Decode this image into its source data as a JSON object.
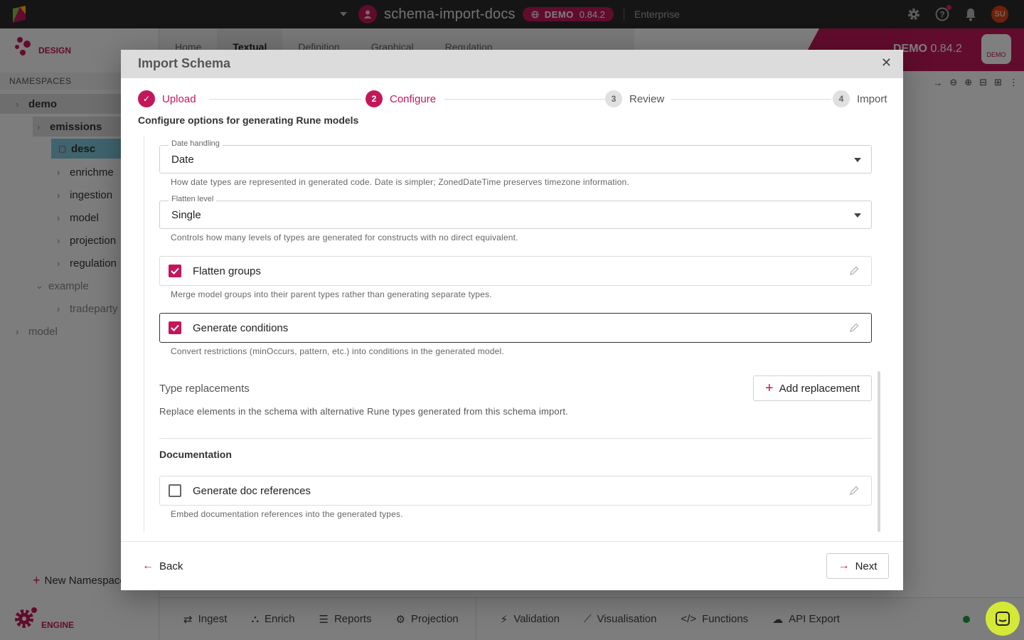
{
  "topbar": {
    "project_name": "schema-import-docs",
    "version_tag": "DEMO",
    "version": "0.84.2",
    "edition": "Enterprise",
    "user_initials": "SU",
    "icons": [
      "settings-icon",
      "help-icon",
      "bell-icon"
    ]
  },
  "sidebar": {
    "logo_label": "DESIGN",
    "namespaces_header": "NAMESPACES",
    "items": [
      {
        "label": "demo"
      },
      {
        "label": "emissions"
      },
      {
        "label": "desc"
      },
      {
        "label": "enrichme"
      },
      {
        "label": "ingestion"
      },
      {
        "label": "model"
      },
      {
        "label": "projection"
      },
      {
        "label": "regulation"
      },
      {
        "label": "example"
      },
      {
        "label": "tradeparty"
      },
      {
        "label": "model"
      }
    ],
    "new_namespace": "New Namespace",
    "engine_label": "ENGINE"
  },
  "tabs": [
    "Home",
    "Textual",
    "Definition",
    "Graphical",
    "Regulation"
  ],
  "demo_banner": {
    "tag": "DEMO",
    "version": "0.84.2",
    "box": "DEMO"
  },
  "bottom_bar": [
    "Ingest",
    "Enrich",
    "Reports",
    "Projection",
    "Validation",
    "Visualisation",
    "Functions",
    "API Export"
  ],
  "modal": {
    "title": "Import Schema",
    "steps": [
      {
        "number": "1",
        "label": "Upload",
        "state": "done"
      },
      {
        "number": "2",
        "label": "Configure",
        "state": "current"
      },
      {
        "number": "3",
        "label": "Review",
        "state": "pending"
      },
      {
        "number": "4",
        "label": "Import",
        "state": "pending"
      }
    ],
    "subtitle": "Configure options for generating Rune models",
    "date_handling": {
      "label": "Date handling",
      "value": "Date",
      "helper": "How date types are represented in generated code. Date is simpler; ZonedDateTime preserves timezone information."
    },
    "flatten_level": {
      "label": "Flatten level",
      "value": "Single",
      "helper": "Controls how many levels of types are generated for constructs with no direct equivalent."
    },
    "flatten_groups": {
      "label": "Flatten groups",
      "checked": true,
      "helper": "Merge model groups into their parent types rather than generating separate types."
    },
    "generate_conditions": {
      "label": "Generate conditions",
      "checked": true,
      "helper": "Convert restrictions (minOccurs, pattern, etc.) into conditions in the generated model."
    },
    "type_replacements": {
      "label": "Type replacements",
      "add_button": "Add replacement",
      "description": "Replace elements in the schema with alternative Rune types generated from this schema import."
    },
    "documentation": {
      "title": "Documentation",
      "generate_doc_refs": {
        "label": "Generate doc references",
        "checked": false,
        "helper": "Embed documentation references into the generated types."
      }
    },
    "back_label": "Back",
    "next_label": "Next"
  },
  "colors": {
    "accent": "#c2185b",
    "topbar": "#2b2b2b",
    "chat": "#d4e838",
    "status": "#1b9e3e"
  }
}
